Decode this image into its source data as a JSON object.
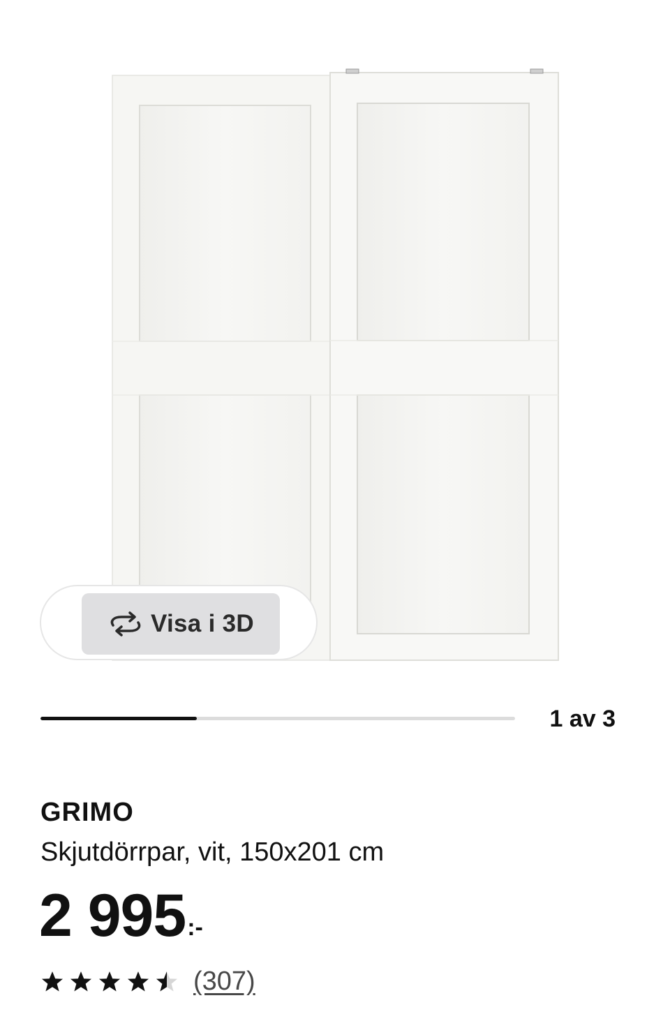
{
  "gallery": {
    "view_3d_label": "Visa i 3D",
    "view_3d_icon": "rotate-3d-icon",
    "current": 1,
    "total": 3,
    "progress_fraction": 0.33,
    "counter_text": "1 av 3"
  },
  "product": {
    "brand": "GRIMO",
    "description": "Skjutdörrpar, vit, 150x201 cm",
    "price_amount": "2 995",
    "price_suffix": ":-",
    "rating_value": 4.5,
    "rating_max": 5,
    "review_count": "(307)"
  },
  "colors": {
    "door_white": "#f7f7f5",
    "button_gray": "#dfdfe1",
    "progress_track": "#dcdcdc",
    "progress_fill": "#111111"
  }
}
